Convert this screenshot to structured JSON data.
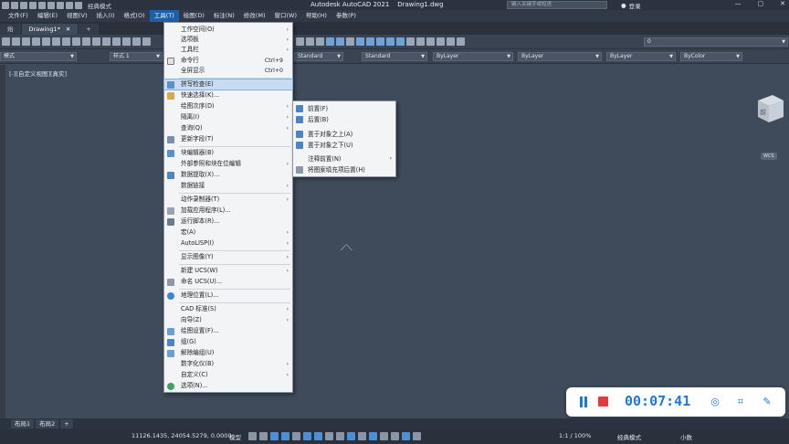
{
  "titlebar": {
    "workspace": "经典模式",
    "app_title": "Autodesk AutoCAD 2021",
    "file_name": "Drawing1.dwg",
    "search_placeholder": "键入关键字或短语",
    "login": "登录"
  },
  "menubar": [
    "文件(F)",
    "编辑(E)",
    "视图(V)",
    "插入(I)",
    "格式(O)",
    "工具(T)",
    "绘图(D)",
    "标注(N)",
    "修改(M)",
    "窗口(W)",
    "帮助(H)",
    "参数(P)"
  ],
  "tabs": {
    "start": "始",
    "drawing": "Drawing1*",
    "close": "✕",
    "add": "+"
  },
  "toolbar2": {
    "layer_mode": "模式",
    "style": "样式 1",
    "dim_style": "Standard",
    "text_style": "Standard",
    "layer_top": "0",
    "color": "ByLayer",
    "linetype": "ByLayer",
    "lineweight": "ByLayer",
    "plotstyle": "ByColor"
  },
  "viewport_label": "[-][自定义视图][真实]",
  "viewcube": {
    "face": "前",
    "wcs": "WCS"
  },
  "tools_menu": [
    {
      "label": "工作空间(O)",
      "sub": true
    },
    {
      "label": "选项板",
      "sub": true
    },
    {
      "label": "工具栏",
      "sub": true
    },
    {
      "label": "命令行",
      "shortcut": "Ctrl+9"
    },
    {
      "label": "全屏显示",
      "shortcut": "Ctrl+0"
    },
    {
      "label": "拼写检查(E)"
    },
    {
      "label": "快速选择(K)..."
    },
    {
      "label": "绘图次序(D)",
      "sub": true
    },
    {
      "label": "隔离(I)",
      "sub": true
    },
    {
      "label": "查询(Q)",
      "sub": true
    },
    {
      "label": "更新字段(T)"
    },
    {
      "label": "块编辑器(B)"
    },
    {
      "label": "外部参照和块在位编辑",
      "sub": true
    },
    {
      "label": "数据提取(X)..."
    },
    {
      "label": "数据链接",
      "sub": true
    },
    {
      "label": "动作录制器(T)",
      "sub": true
    },
    {
      "label": "加载应用程序(L)..."
    },
    {
      "label": "运行脚本(R)..."
    },
    {
      "label": "宏(A)",
      "sub": true
    },
    {
      "label": "AutoLISP(I)",
      "sub": true
    },
    {
      "label": "显示图像(Y)",
      "sub": true
    },
    {
      "label": "新建 UCS(W)",
      "sub": true
    },
    {
      "label": "命名 UCS(U)..."
    },
    {
      "label": "地理位置(L)..."
    },
    {
      "label": "CAD 标准(S)",
      "sub": true
    },
    {
      "label": "向导(Z)",
      "sub": true
    },
    {
      "label": "绘图设置(F)..."
    },
    {
      "label": "组(G)"
    },
    {
      "label": "解除编组(U)"
    },
    {
      "label": "数字化仪(B)",
      "sub": true
    },
    {
      "label": "自定义(C)",
      "sub": true
    },
    {
      "label": "选项(N)..."
    }
  ],
  "draw_order_submenu": [
    {
      "label": "前置(F)"
    },
    {
      "label": "后置(B)"
    },
    {
      "label": "置于对象之上(A)"
    },
    {
      "label": "置于对象之下(U)"
    },
    {
      "label": "注释前置(N)",
      "sub": true
    },
    {
      "label": "将图案填充项后置(H)"
    }
  ],
  "submenu_arrow": "›",
  "recorder": {
    "time": "00:07:41"
  },
  "layout_tabs": [
    "布局1",
    "布局2",
    "+"
  ],
  "statusbar": {
    "coords": "11126.1435, 24054.5279, 0.0000",
    "model": "模型",
    "scale": "1:1 / 100%",
    "workspace": "经典模式",
    "units": "小数"
  }
}
